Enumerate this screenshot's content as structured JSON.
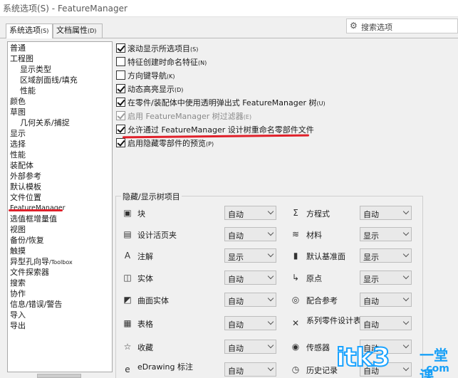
{
  "window": {
    "title": "系统选项(S) - FeatureManager"
  },
  "tabs": [
    {
      "label": "系统选项",
      "key": "(S)"
    },
    {
      "label": "文档属性",
      "key": "(D)"
    }
  ],
  "search": {
    "placeholder": "搜索选项",
    "icon": "gear-search-icon"
  },
  "tree": [
    {
      "label": "普通"
    },
    {
      "label": "工程图"
    },
    {
      "label": "显示类型"
    },
    {
      "label": "区域剖面线/填充"
    },
    {
      "label": "性能"
    },
    {
      "label": "颜色"
    },
    {
      "label": "草图"
    },
    {
      "label": "几何关系/捕捉"
    },
    {
      "label": "显示"
    },
    {
      "label": "选择"
    },
    {
      "label": "性能"
    },
    {
      "label": "装配体"
    },
    {
      "label": "外部参考"
    },
    {
      "label": "默认模板"
    },
    {
      "label": "文件位置"
    },
    {
      "label": "FeatureManager"
    },
    {
      "label": "选值框增量值"
    },
    {
      "label": "视图"
    },
    {
      "label": "备份/恢复"
    },
    {
      "label": "触摸"
    },
    {
      "label": "异型孔向导",
      "suffix": "/Toolbox"
    },
    {
      "label": "文件探索器"
    },
    {
      "label": "搜索"
    },
    {
      "label": "协作"
    },
    {
      "label": "信息/错误/警告"
    },
    {
      "label": "导入"
    },
    {
      "label": "导出"
    }
  ],
  "options": [
    {
      "label": "滚动显示所选项目",
      "key": "(S)",
      "checked": true,
      "disabled": false
    },
    {
      "label": "特征创建时命名特征",
      "key": "(N)",
      "checked": false,
      "disabled": false
    },
    {
      "label": "方向键导航",
      "key": "(K)",
      "checked": false,
      "disabled": false
    },
    {
      "label": "动态高亮显示",
      "key": "(D)",
      "checked": true,
      "disabled": false
    },
    {
      "label": "在零件/装配体中使用透明弹出式 FeatureManager 树",
      "key": "(U)",
      "checked": true,
      "disabled": false
    },
    {
      "label": "启用 FeatureManager 树过滤器",
      "key": "(E)",
      "checked": true,
      "disabled": true
    },
    {
      "label": "允许通过 FeatureManager 设计树重命名零部件文件",
      "key": "",
      "checked": true,
      "disabled": false
    },
    {
      "label": "启用隐藏零部件的预览",
      "key": "(P)",
      "checked": true,
      "disabled": false
    }
  ],
  "hide_show": {
    "title": "隐藏/显示树项目",
    "left": [
      {
        "icon": "block-icon",
        "glyph": "▣",
        "label": "块",
        "value": "自动"
      },
      {
        "icon": "design-binder-icon",
        "glyph": "▤",
        "label": "设计活页夹",
        "value": "自动"
      },
      {
        "icon": "annotation-icon",
        "glyph": "A",
        "label": "注解",
        "value": "显示"
      },
      {
        "icon": "solid-body-icon",
        "glyph": "◫",
        "label": "实体",
        "value": "自动"
      },
      {
        "icon": "surface-body-icon",
        "glyph": "◩",
        "label": "曲面实体",
        "value": "自动"
      },
      {
        "icon": "table-icon",
        "glyph": "▦",
        "label": "表格",
        "value": "自动"
      },
      {
        "icon": "favorites-icon",
        "glyph": "☆",
        "label": "收藏",
        "value": "自动"
      },
      {
        "icon": "edrawing-markup-icon",
        "glyph": "e",
        "label": "eDrawing 标注",
        "value": "自动"
      }
    ],
    "right": [
      {
        "icon": "equation-icon",
        "glyph": "Σ",
        "label": "方程式",
        "value": "自动"
      },
      {
        "icon": "material-icon",
        "glyph": "≋",
        "label": "材料",
        "value": "显示"
      },
      {
        "icon": "default-plane-icon",
        "glyph": "▮",
        "label": "默认基准面",
        "value": "显示"
      },
      {
        "icon": "origin-icon",
        "glyph": "↳",
        "label": "原点",
        "value": "显示"
      },
      {
        "icon": "mate-reference-icon",
        "glyph": "◎",
        "label": "配合参考",
        "value": "自动"
      },
      {
        "icon": "design-table-icon",
        "glyph": "✕",
        "label": "系列零件设计表",
        "value": "自动"
      },
      {
        "icon": "sensor-icon",
        "glyph": "◉",
        "label": "传感器",
        "value": "自动"
      },
      {
        "icon": "history-icon",
        "glyph": "◷",
        "label": "历史记录",
        "value": "自动"
      }
    ]
  },
  "watermark": {
    "text": "itk3",
    "cn": "一堂课",
    "domain": ".com"
  },
  "colors": {
    "highlight_underline": "#e0202a",
    "watermark_blue": "#1aa3ff"
  }
}
